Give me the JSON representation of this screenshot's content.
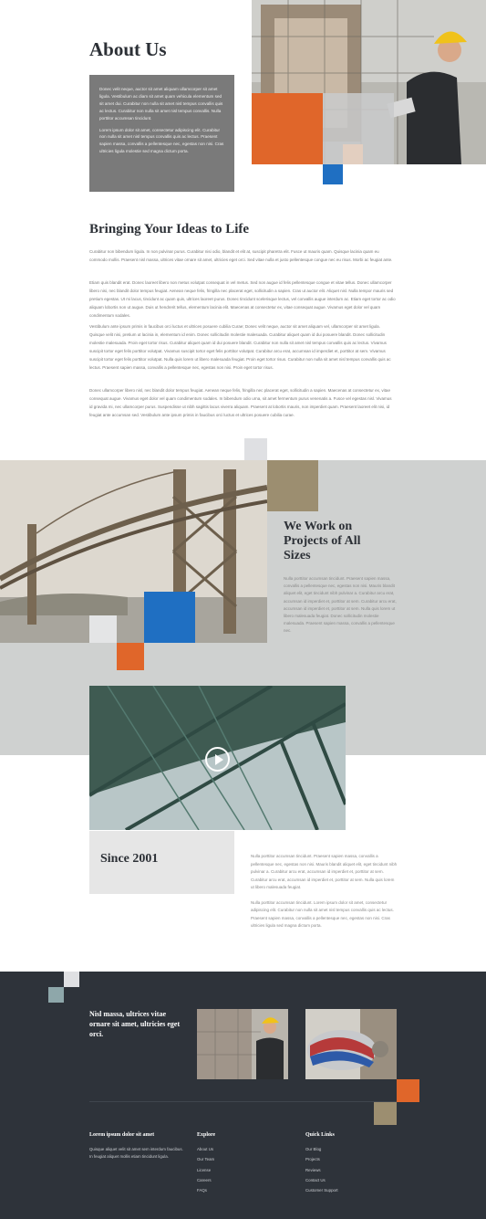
{
  "about": {
    "title": "About Us",
    "box_p1": "Donec velit neque, auctor sit amet aliquam ullamcorper sit amet ligula. Vestibulum ac diam sit amet quam vehicula elementum sed sit amet dui. Curabitur non nulla sit amet nisl tempus convallis quis ac lectus. Curabitur non nulla sit amet nisl tempus convallis. Nulla porttitor accumsan tincidunt.",
    "box_p2": "Lorem ipsum dolor sit amet, consectetur adipiscing elit. Curabitur non nulla sit amet nisl tempus convallis quis ac lectus. Praesent sapien massa, convallis a pellentesque nec, egestas non nisi. Cras ultricies ligula molestie sed magna dictum porta."
  },
  "bringing": {
    "title": "Bringing Your Ideas to Life",
    "p1": "Curabitur non bibendum ligula. In non pulvinar purus. Curabitur nisi odio, blandit et elit at, suscipit pharetra elit. Fusce ut mauris quam. Quisque lacinia quam eu commodo mollis. Praesent nisl massa, ultrices vitae ornare sit amet, ultricies eget orci. Sed vitae nulla et justo pellentesque congue nec eu risus. Morbi ac feugiat ante.",
    "p2": "Etiam quis blandit erat. Donec laoreet libero non metus volutpat consequat in vel metus. Sed non augue id felis pellentesque congue et vitae tellus. Donec ullamcorper libero nisi, nec blandit dolor tempus feugiat. Aenean neque felis, fringilla nec placerat eget, sollicitudin a sapien. Cras ut auctor elit. Aliquet nisl. Nulla tempor mauris sed pretium egestas. Ut mi lacus, tincidunt ac quam quis, ultrices laoreet purus. Donec tincidunt scelerisque lectus, vel convallis augue interdum ac. Etiam eget tortor ac odio aliquam lobortis non ut augue. Duis ut hendrerit tellus, elementum lacinia elit. Maecenas at consectetur ex, vitae consequat augue. Vivamus eget dolor vel quam condimentum sodales.",
    "p3": "Vestibulum ante ipsum primis in faucibus orci luctus et ultrices posuere cubilia Curae; Donec velit neque, auctor sit amet aliquam vel, ullamcorper sit amet ligula. Quisque velit nisi, pretium ut lacinia in, elementum id enim. Donec sollicitudin molestie malesuada. Curabitur aliquet quam id dui posuere blandit. Donec sollicitudin molestie malesuada. Proin eget tortor risus. Curabitur aliquet quam id dui posuere blandit. Curabitur non nulla sit amet nisl tempus convallis quis ac lectus. Vivamus suscipit tortor eget felis porttitor volutpat. Vivamus suscipit tortor eget felis porttitor volutpat. Curabitur arcu erat, accumsan id imperdiet et, porttitor at sem. Vivamus suscipit tortor eget felis porttitor volutpat. Nulla quis lorem ut libero malesuada feugiat. Proin eget tortor risus. Curabitur non nulla sit amet nisl tempus convallis quis ac lectus. Praesent sapien massa, convallis a pellentesque nec, egestas non nisi. Proin eget tortor risus.",
    "p4": "Donec ullamcorper libero nisl, nec blandit dolor tempus feugiat. Aenean neque felis, fringilla nec placerat eget, sollicitudin a sapien. Maecenas at consectetur ex, vitae consequat augue. Vivamus eget dolor vel quam condimentum sodales. In bibendum odio urna, sit amet fermentum purus venenatis a. Fusce vel egestas nisl. Vivamus id gravida mi, nec ullamcorper purus. Suspendisse ut nibh sagittis lacus viverra aliquam. Praesent at lobortis mauris, non imperdiet quam. Praesent laoreet elit nisi, id feugiat ante accumsan sed. Vestibulum ante ipsum primis in faucibus orci luctus et ultrices posuere cubilia curae."
  },
  "work": {
    "title": "We Work on Projects of All Sizes",
    "text": "Nulla porttitor accumsan tincidunt. Praesent sapien massa, convallis a pellentesque nec, egestas non nisi. Mauris blandit aliquet elit, eget tincidunt nibh pulvinar a. Curabitur arcu erat, accumsan id imperdiet et, porttitor at sem. Curabitur arcu erat, accumsan id imperdiet et, porttitor at sem. Nulla quis lorem ut libero malesuada feugiat. Donec sollicitudin molestie malesuada. Praesent sapien massa, convallis a pellentesque nec."
  },
  "since": {
    "title": "Since 2001",
    "p1": "Nulla porttitor accumsan tincidunt. Praesent sapien massa, convallis a pellentesque nec, egestas non nisi. Mauris blandit aliquet elit, eget tincidunt nibh pulvinar a. Curabitur arcu erat, accumsan id imperdiet et, porttitor at sem. Curabitur arcu erat, accumsan id imperdiet et, porttitor at sem. Nulla quis lorem ut libero malesuada feugiat.",
    "p2": "Nulla porttitor accumsan tincidunt. Lorem ipsum dolor sit amet, consectetur adipiscing elit. Curabitur non nulla sit amet nisl tempus convallis quis ac lectus. Praesent sapien massa, convallis a pellentesque nec, egestas non nisi. Cras ultricies ligula sed magna dictum porta."
  },
  "footer": {
    "headline": "Nisl massa, ultrices vitae ornare sit amet, ultricies eget orci.",
    "col1_title": "Lorem ipsum dolor sit amet",
    "col1_text": "Quisque aliquet velit sit amet sem interdum faucibus. In feugiat aliquet mollis etiam tincidunt ligula.",
    "col2_title": "Explore",
    "explore_links": [
      "About Us",
      "Our Team",
      "License",
      "Careers",
      "FAQs"
    ],
    "col3_title": "Quick Links",
    "quick_links": [
      "Our Blog",
      "Projects",
      "Reviews",
      "Contact Us",
      "Customer Support"
    ]
  },
  "colors": {
    "orange": "#e0662a",
    "blue": "#1f6fc2",
    "taupe": "#9c8e70",
    "dark": "#2e333a",
    "band_gray": "#cfd1d0"
  },
  "icons": {
    "video": "play-icon"
  }
}
